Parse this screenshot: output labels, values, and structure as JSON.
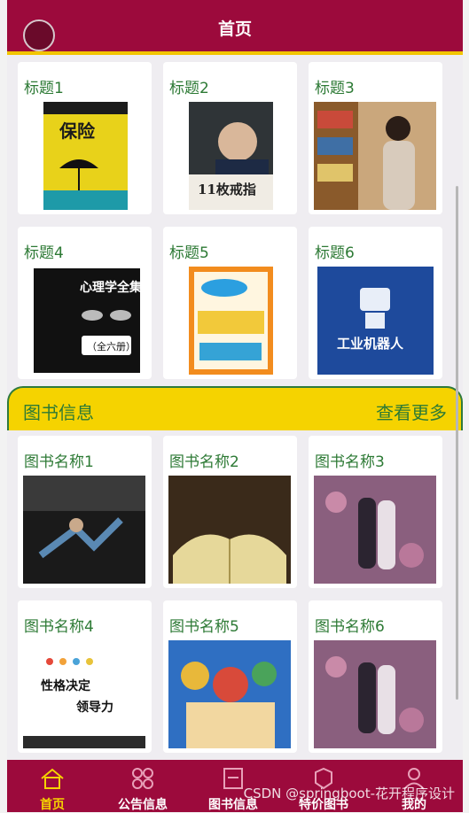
{
  "header": {
    "title": "首页"
  },
  "banner_cards": [
    {
      "title": "标题1",
      "cover": "insurance-book-cover"
    },
    {
      "title": "标题2",
      "cover": "eleven-rings-book-cover"
    },
    {
      "title": "标题3",
      "cover": "library-reader-photo"
    },
    {
      "title": "标题4",
      "cover": "psychology-collection-cover"
    },
    {
      "title": "标题5",
      "cover": "chinese-reading-book-cover"
    },
    {
      "title": "标题6",
      "cover": "industrial-robot-book-cover"
    }
  ],
  "section": {
    "title": "图书信息",
    "more": "查看更多"
  },
  "book_cards": [
    {
      "title": "图书名称1",
      "cover": "running-man-book-cover"
    },
    {
      "title": "图书名称2",
      "cover": "open-book-photo"
    },
    {
      "title": "图书名称3",
      "cover": "couple-night-photo"
    },
    {
      "title": "图书名称4",
      "cover": "leadership-book-cover"
    },
    {
      "title": "图书名称5",
      "cover": "one-piece-poster"
    },
    {
      "title": "图书名称6",
      "cover": "couple-night-photo"
    }
  ],
  "cover_texts": {
    "insurance": "保险",
    "eleven": "11枚戒指",
    "psych": "心理学全集",
    "psych_sub": "（全六册）",
    "robot": "工业机器人",
    "leader": "性格决定",
    "leader2": "领导力"
  },
  "tabs": [
    {
      "label": "首页",
      "icon": "home-icon",
      "active": true
    },
    {
      "label": "公告信息",
      "icon": "grid-icon",
      "active": false
    },
    {
      "label": "图书信息",
      "icon": "book-icon",
      "active": false
    },
    {
      "label": "特价图书",
      "icon": "tag-icon",
      "active": false
    },
    {
      "label": "我的",
      "icon": "user-icon",
      "active": false
    }
  ],
  "watermark": "CSDN @springboot-花开程序设计",
  "colors": {
    "primary": "#9c0a3c",
    "accent": "#f5d300",
    "green": "#2d7a35"
  }
}
